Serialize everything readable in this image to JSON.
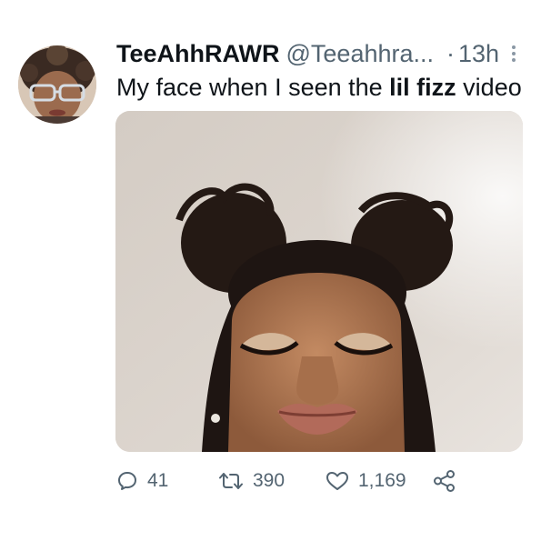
{
  "tweet": {
    "display_name": "TeeAhhRAWR",
    "handle": "@Teeahhra...",
    "separator": "·",
    "time": "13h",
    "text_before": "My face when I seen the ",
    "text_bold": "lil fizz",
    "text_after": " video"
  },
  "metrics": {
    "replies": "41",
    "retweets": "390",
    "likes": "1,169"
  },
  "icons": {
    "reply": "reply-icon",
    "retweet": "retweet-icon",
    "like": "heart-icon",
    "share": "share-icon",
    "more": "more-options-icon"
  },
  "colors": {
    "text": "#0f1419",
    "secondary": "#536471",
    "more_dots": "#8b98a5"
  }
}
